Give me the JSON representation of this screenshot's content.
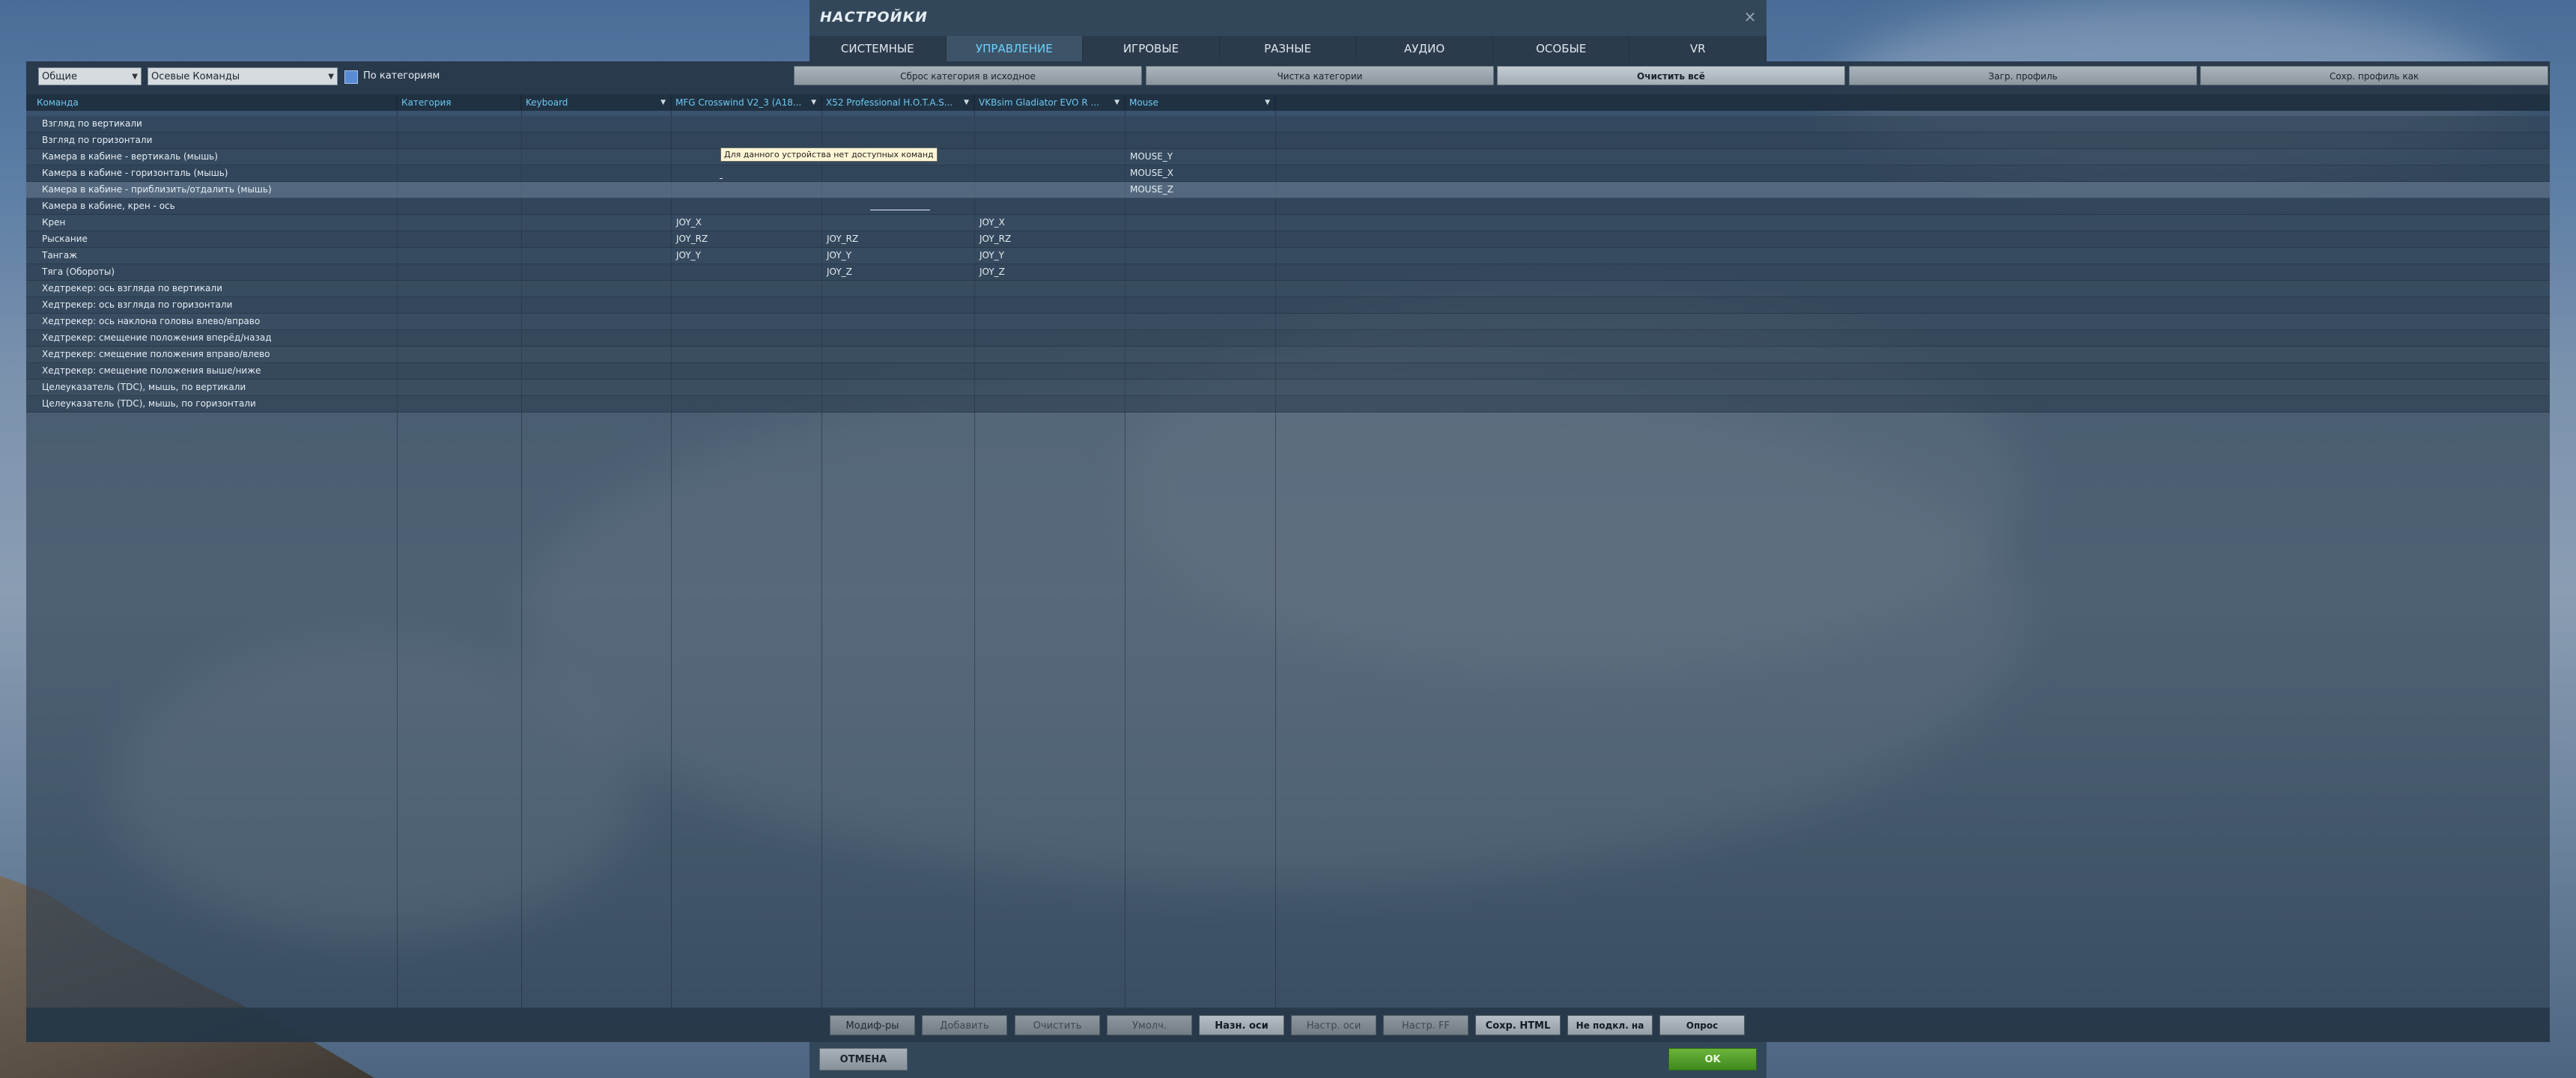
{
  "dialog": {
    "title": "НАСТРОЙКИ",
    "close_glyph": "×"
  },
  "tabs": [
    {
      "label": "СИСТЕМНЫЕ",
      "active": false
    },
    {
      "label": "УПРАВЛЕНИЕ",
      "active": true
    },
    {
      "label": "ИГРОВЫЕ",
      "active": false
    },
    {
      "label": "РАЗНЫЕ",
      "active": false
    },
    {
      "label": "АУДИО",
      "active": false
    },
    {
      "label": "ОСОБЫЕ",
      "active": false
    },
    {
      "label": "VR",
      "active": false
    }
  ],
  "toolbar": {
    "aircraft_select": "Общие",
    "category_select": "Осевые Команды",
    "by_category_label": "По категориям",
    "by_category_checked": true,
    "buttons": [
      "Сброс категория в исходное",
      "Чистка категории",
      "Очистить всё",
      "Загр. профиль",
      "Сохр. профиль как"
    ]
  },
  "table": {
    "headers": [
      "Команда",
      "Категория",
      "Keyboard",
      "MFG Crosswind V2_3 (A18...",
      "X52 Professional H.O.T.A.S...",
      "VKBsim Gladiator EVO R ...",
      "Mouse"
    ],
    "rows": [
      {
        "cmd": "Взгляд по вертикали",
        "mfg": "",
        "x52": "",
        "vkb": "",
        "mouse": ""
      },
      {
        "cmd": "Взгляд по горизонтали",
        "mfg": "",
        "x52": "",
        "vkb": "",
        "mouse": ""
      },
      {
        "cmd": "Камера в кабине - вертикаль (мышь)",
        "mfg": "",
        "x52": "",
        "vkb": "",
        "mouse": "MOUSE_Y"
      },
      {
        "cmd": "Камера в кабине - горизонталь (мышь)",
        "mfg": "",
        "x52": "",
        "vkb": "",
        "mouse": "MOUSE_X"
      },
      {
        "cmd": "Камера в кабине - приблизить/отдалить (мышь)",
        "mfg": "",
        "x52": "",
        "vkb": "",
        "mouse": "MOUSE_Z"
      },
      {
        "cmd": "Камера в кабине, крен - ось",
        "mfg": "",
        "x52": "",
        "vkb": "",
        "mouse": ""
      },
      {
        "cmd": "Крен",
        "mfg": "JOY_X",
        "x52": "",
        "vkb": "JOY_X",
        "mouse": ""
      },
      {
        "cmd": "Рыскание",
        "mfg": "JOY_RZ",
        "x52": "JOY_RZ",
        "vkb": "JOY_RZ",
        "mouse": ""
      },
      {
        "cmd": "Тангаж",
        "mfg": "JOY_Y",
        "x52": "JOY_Y",
        "vkb": "JOY_Y",
        "mouse": ""
      },
      {
        "cmd": "Тяга (Обороты)",
        "mfg": "",
        "x52": "JOY_Z",
        "vkb": "JOY_Z",
        "mouse": ""
      },
      {
        "cmd": "Хедтрекер: ось взгляда по вертикали",
        "mfg": "",
        "x52": "",
        "vkb": "",
        "mouse": ""
      },
      {
        "cmd": "Хедтрекер: ось взгляда по горизонтали",
        "mfg": "",
        "x52": "",
        "vkb": "",
        "mouse": ""
      },
      {
        "cmd": "Хедтрекер: ось наклона головы влево/вправо",
        "mfg": "",
        "x52": "",
        "vkb": "",
        "mouse": ""
      },
      {
        "cmd": "Хедтрекер: смещение положения вперёд/назад",
        "mfg": "",
        "x52": "",
        "vkb": "",
        "mouse": ""
      },
      {
        "cmd": "Хедтрекер: смещение положения вправо/влево",
        "mfg": "",
        "x52": "",
        "vkb": "",
        "mouse": ""
      },
      {
        "cmd": "Хедтрекер: смещение положения выше/ниже",
        "mfg": "",
        "x52": "",
        "vkb": "",
        "mouse": ""
      },
      {
        "cmd": "Целеуказатель (TDC), мышь, по вертикали",
        "mfg": "",
        "x52": "",
        "vkb": "",
        "mouse": ""
      },
      {
        "cmd": "Целеуказатель (TDC), мышь, по горизонтали",
        "mfg": "",
        "x52": "",
        "vkb": "",
        "mouse": ""
      }
    ],
    "highlighted_row": 4,
    "tooltip": "Для данного устройства нет доступных команд"
  },
  "bottom_buttons": [
    {
      "label": "Модиф-ры",
      "state": "normal"
    },
    {
      "label": "Добавить",
      "state": "dim"
    },
    {
      "label": "Очистить",
      "state": "dim"
    },
    {
      "label": "Умолч.",
      "state": "dim"
    },
    {
      "label": "Назн. оси",
      "state": "on"
    },
    {
      "label": "Настр. оси",
      "state": "dim"
    },
    {
      "label": "Настр. FF",
      "state": "dim"
    },
    {
      "label": "Сохр. HTML",
      "state": "on"
    },
    {
      "label": "Не подкл. на лету",
      "state": "on"
    },
    {
      "label": "Опрос устройств",
      "state": "on"
    }
  ],
  "footer": {
    "cancel_label": "ОТМЕНА",
    "ok_label": "OK"
  },
  "colors": {
    "accent": "#6ad3ff",
    "ok_green": "#4f9e2a",
    "panel": "#2a3c4e"
  }
}
